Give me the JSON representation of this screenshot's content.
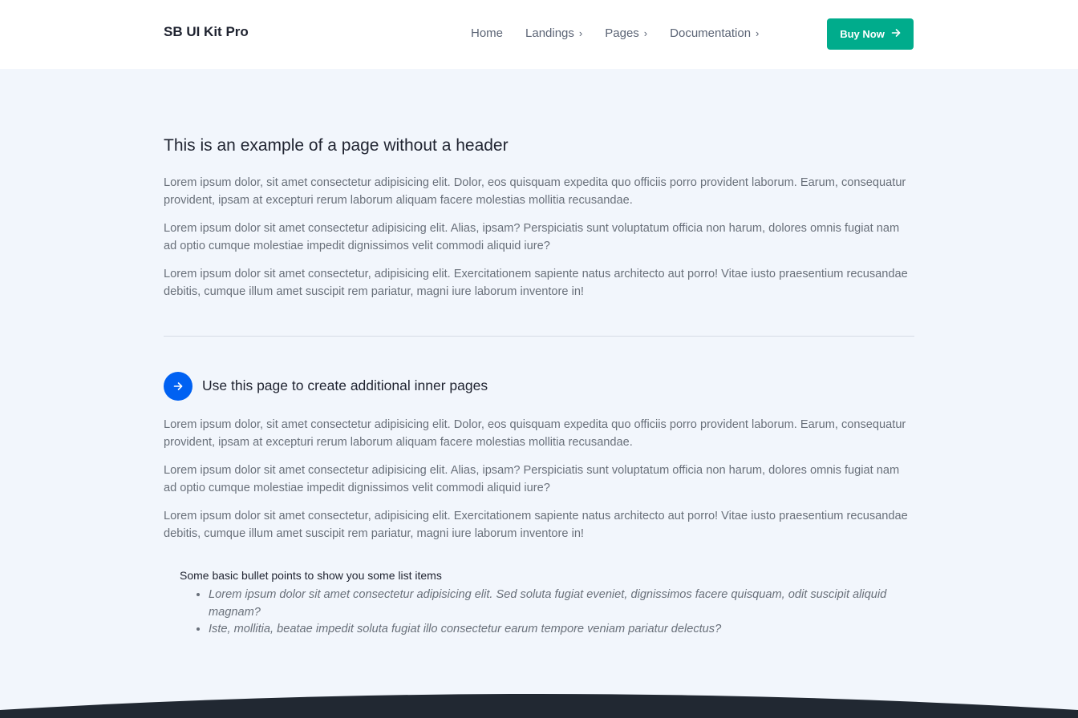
{
  "navbar": {
    "brand": "SB UI Kit Pro",
    "links": [
      {
        "label": "Home",
        "has_chevron": false
      },
      {
        "label": "Landings",
        "has_chevron": true
      },
      {
        "label": "Pages",
        "has_chevron": true
      },
      {
        "label": "Documentation",
        "has_chevron": true
      }
    ],
    "chevron": "›",
    "cta_label": "Buy Now",
    "cta_icon": "arrow-right-icon",
    "cta_color": "#00ac8c"
  },
  "main": {
    "title": "This is an example of a page without a header",
    "paragraphs_1": [
      "Lorem ipsum dolor, sit amet consectetur adipisicing elit. Dolor, eos quisquam expedita quo officiis porro provident laborum. Earum, consequatur provident, ipsam at excepturi rerum laborum aliquam facere molestias mollitia recusandae.",
      "Lorem ipsum dolor sit amet consectetur adipisicing elit. Alias, ipsam? Perspiciatis sunt voluptatum officia non harum, dolores omnis fugiat nam ad optio cumque molestiae impedit dignissimos velit commodi aliquid iure?",
      "Lorem ipsum dolor sit amet consectetur, adipisicing elit. Exercitationem sapiente natus architecto aut porro! Vitae iusto praesentium recusandae debitis, cumque illum amet suscipit rem pariatur, magni iure laborum inventore in!"
    ],
    "subtitle": "Use this page to create additional inner pages",
    "subtitle_icon": "arrow-right-icon",
    "accent_color": "#0061f2",
    "paragraphs_2": [
      "Lorem ipsum dolor, sit amet consectetur adipisicing elit. Dolor, eos quisquam expedita quo officiis porro provident laborum. Earum, consequatur provident, ipsam at excepturi rerum laborum aliquam facere molestias mollitia recusandae.",
      "Lorem ipsum dolor sit amet consectetur adipisicing elit. Alias, ipsam? Perspiciatis sunt voluptatum officia non harum, dolores omnis fugiat nam ad optio cumque molestiae impedit dignissimos velit commodi aliquid iure?",
      "Lorem ipsum dolor sit amet consectetur, adipisicing elit. Exercitationem sapiente natus architecto aut porro! Vitae iusto praesentium recusandae debitis, cumque illum amet suscipit rem pariatur, magni iure laborum inventore in!"
    ],
    "list_title": "Some basic bullet points to show you some list items",
    "list_items": [
      "Lorem ipsum dolor sit amet consectetur adipisicing elit. Sed soluta fugiat eveniet, dignissimos facere quisquam, odit suscipit aliquid magnam?",
      "Iste, mollitia, beatae impedit soluta fugiat illo consectetur earum tempore veniam pariatur delectus?"
    ]
  },
  "footer": {
    "color": "#212832"
  }
}
